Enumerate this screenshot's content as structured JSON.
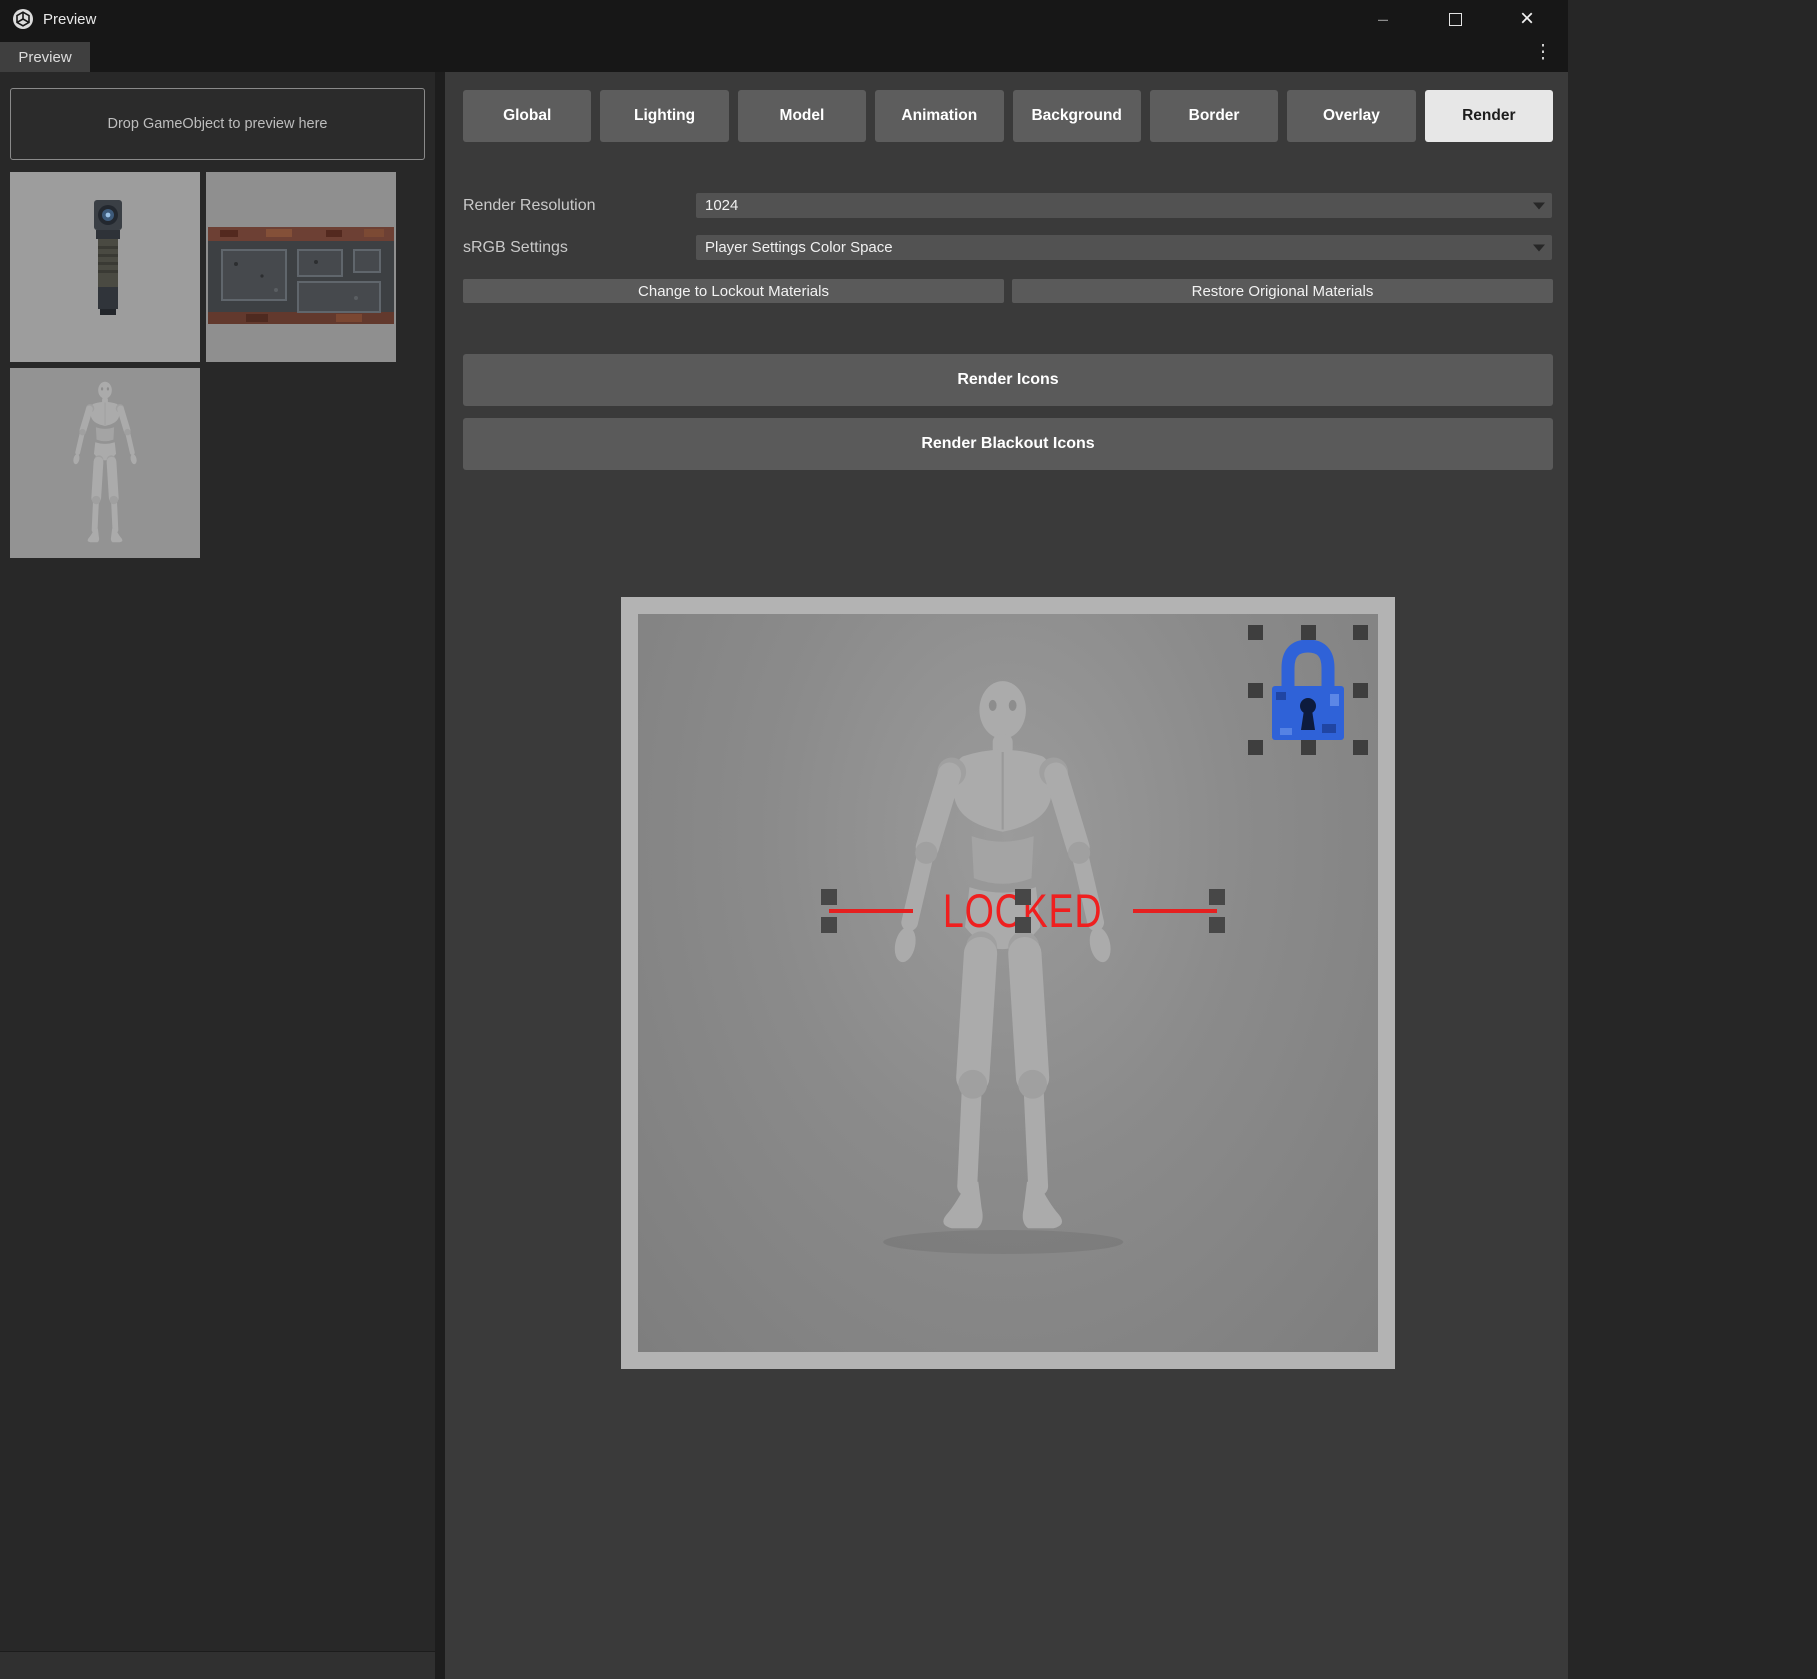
{
  "window": {
    "title": "Preview",
    "tab_label": "Preview"
  },
  "icons": {
    "minimize": "–",
    "close": "×",
    "kebab": "⋮"
  },
  "sidebar": {
    "drop_text": "Drop GameObject to preview here",
    "thumbnails": [
      {
        "label": "flashlight"
      },
      {
        "label": "metal-crate"
      },
      {
        "label": "mannequin"
      }
    ]
  },
  "toolbar": {
    "buttons": [
      "Global",
      "Lighting",
      "Model",
      "Animation",
      "Background",
      "Border",
      "Overlay",
      "Render"
    ],
    "active": "Render"
  },
  "settings": {
    "render_resolution_label": "Render Resolution",
    "render_resolution_value": "1024",
    "srgb_label": "sRGB Settings",
    "srgb_value": "Player Settings Color Space",
    "change_button": "Change to Lockout Materials",
    "restore_button": "Restore Origional Materials"
  },
  "actions": {
    "render_icons": "Render Icons",
    "render_blackout": "Render Blackout Icons"
  },
  "preview": {
    "locked_text": "LOCKED",
    "locked_color": "#ef1f1f",
    "lock_icon_color": "#2f62d8"
  }
}
